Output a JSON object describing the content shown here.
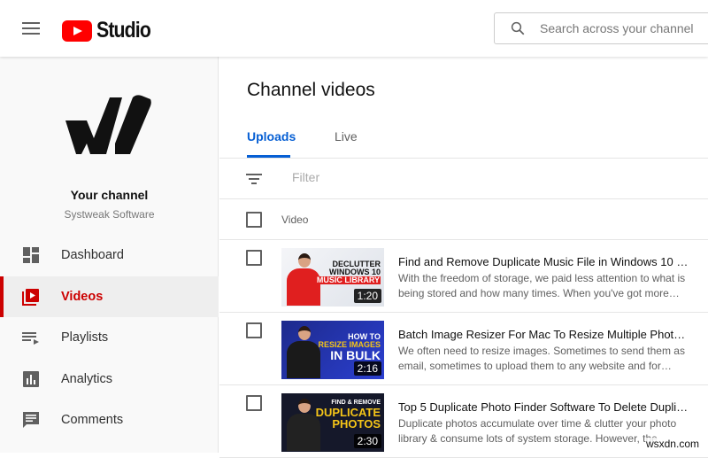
{
  "header": {
    "logo_text": "Studio",
    "search_placeholder": "Search across your channel"
  },
  "sidebar": {
    "channel_title": "Your channel",
    "channel_name": "Systweak Software",
    "items": [
      {
        "label": "Dashboard",
        "icon": "dashboard-icon"
      },
      {
        "label": "Videos",
        "icon": "videos-icon",
        "active": true
      },
      {
        "label": "Playlists",
        "icon": "playlists-icon"
      },
      {
        "label": "Analytics",
        "icon": "analytics-icon"
      },
      {
        "label": "Comments",
        "icon": "comments-icon"
      }
    ]
  },
  "main": {
    "title": "Channel videos",
    "tabs": [
      {
        "label": "Uploads",
        "active": true
      },
      {
        "label": "Live"
      }
    ],
    "filter_placeholder": "Filter",
    "column_video": "Video",
    "videos": [
      {
        "thumb_text": [
          "DECLUTTER",
          "WINDOWS 10",
          "MUSIC LIBRARY"
        ],
        "duration": "1:20",
        "title": "Find and Remove Duplicate Music File in Windows 10 | ...",
        "description": "With the freedom of storage, we paid less attention to what is being stored and how many times. When you've got more…"
      },
      {
        "thumb_text": [
          "HOW TO",
          "RESIZE IMAGES",
          "IN BULK"
        ],
        "duration": "2:16",
        "title": "Batch Image Resizer For Mac To Resize Multiple Photos…",
        "description": "We often need to resize images. Sometimes to send them as email, sometimes to upload them to any website and for…"
      },
      {
        "thumb_text": [
          "FIND & REMOVE",
          "DUPLICATE",
          "PHOTOS"
        ],
        "duration": "2:30",
        "title": "Top 5 Duplicate Photo Finder Software To Delete Duplic…",
        "description": "Duplicate photos accumulate over time & clutter your photo library & consume lots of system storage. However, the…"
      }
    ]
  },
  "watermark": "wsxdn.com",
  "colors": {
    "accent": "#065fd4",
    "brand": "#ff0000",
    "active_nav": "#cc0000"
  }
}
